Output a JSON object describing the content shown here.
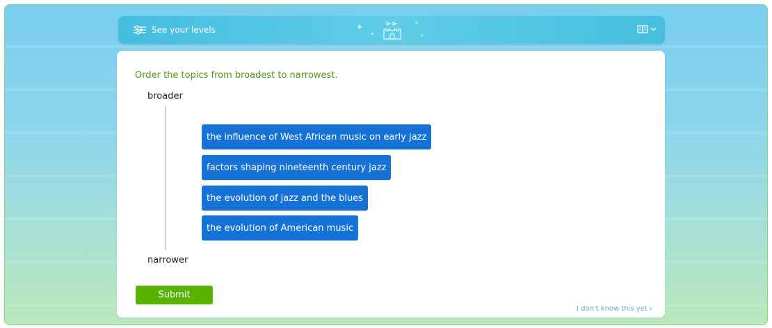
{
  "level_bar": {
    "levels_label": "See your levels",
    "levels_icon": "sliders-icon",
    "castle_icon": "castle-icon",
    "book_icon": "book-icon",
    "dropdown_icon": "chevron-down-icon"
  },
  "question": {
    "prompt": "Order the topics from broadest to narrowest.",
    "top_label": "broader",
    "bottom_label": "narrower",
    "tiles": [
      {
        "label": "the influence of West African music on early jazz"
      },
      {
        "label": "factors shaping nineteenth century jazz"
      },
      {
        "label": "the evolution of jazz and the blues"
      },
      {
        "label": "the evolution of American music"
      }
    ]
  },
  "actions": {
    "submit_label": "Submit",
    "dont_know_label": "I don't know this yet ›"
  },
  "colors": {
    "accent_green": "#58b200",
    "prompt_green": "#4f9a16",
    "tile_blue": "#1672d6",
    "bar_blue": "#45bde0"
  }
}
